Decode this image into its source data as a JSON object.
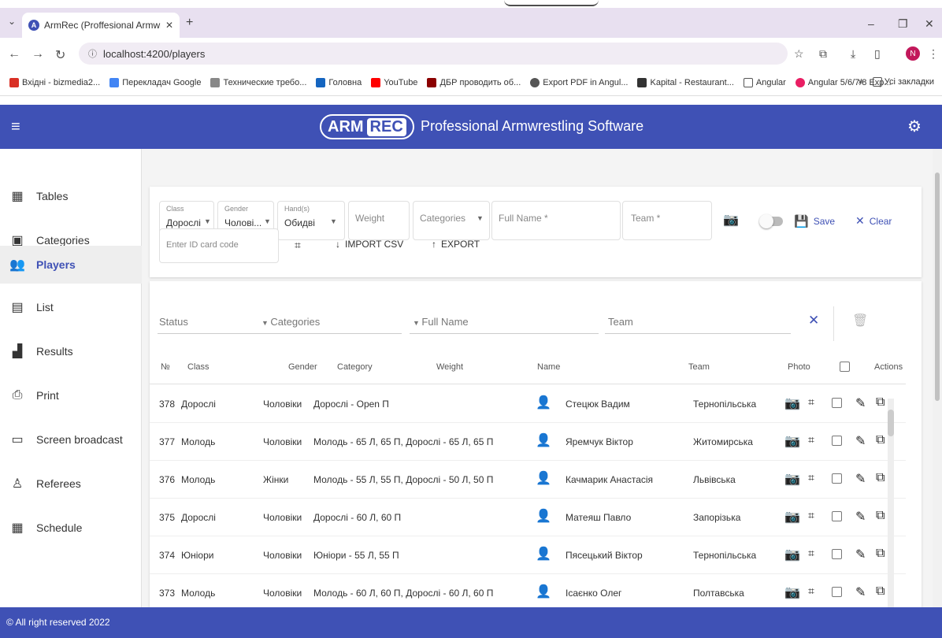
{
  "browser": {
    "tab_title": "ArmRec (Proffesional Armwrestl",
    "url": "localhost:4200/players",
    "bookmarks": [
      "Вхідні - bizmedia2...",
      "Перекладач Google",
      "Технические требо...",
      "Головна",
      "YouTube",
      "ДБР проводить об...",
      "Export PDF in Angul...",
      "Kapital - Restaurant...",
      "Angular",
      "Angular 5/6/7/8 Exp..."
    ],
    "bookmarks_more": "»",
    "bookmarks_folder": "Усі закладки",
    "profile_initial": "N"
  },
  "app": {
    "logo_left": "ARM",
    "logo_right": "REC",
    "subtitle": "Professional Armwrestling Software",
    "accent": "#3f51b5"
  },
  "sidebar": {
    "items": [
      {
        "label": "Tables",
        "icon": "tables-icon"
      },
      {
        "label": "Categories",
        "icon": "categories-icon"
      },
      {
        "label": "Players",
        "icon": "players-icon",
        "active": true
      },
      {
        "label": "List",
        "icon": "list-icon"
      },
      {
        "label": "Results",
        "icon": "results-icon"
      },
      {
        "label": "Print",
        "icon": "print-icon"
      },
      {
        "label": "Screen broadcast",
        "icon": "cast-icon"
      },
      {
        "label": "Referees",
        "icon": "referees-icon"
      },
      {
        "label": "Schedule",
        "icon": "schedule-icon"
      }
    ]
  },
  "form": {
    "class_label": "Class",
    "class_value": "Дорослі",
    "gender_label": "Gender",
    "gender_value": "Чолові...",
    "hands_label": "Hand(s)",
    "hands_value": "Обидві",
    "weight_placeholder": "Weight",
    "categories_placeholder": "Categories",
    "fullname_placeholder": "Full Name *",
    "team_placeholder": "Team *",
    "save_label": "Save",
    "clear_label": "Clear",
    "idcard_placeholder": "Enter ID card code",
    "import_label": "IMPORT CSV",
    "export_label": "EXPORT"
  },
  "filters": {
    "status": "Status",
    "categories": "Categories",
    "fullname": "Full Name",
    "team": "Team"
  },
  "table": {
    "headers": {
      "no": "№",
      "class": "Class",
      "gender": "Gender",
      "category": "Category",
      "weight": "Weight",
      "name": "Name",
      "team": "Team",
      "photo": "Photo",
      "actions": "Actions"
    },
    "rows": [
      {
        "no": "378",
        "class": "Дорослі",
        "gender": "Чоловіки",
        "category": "Дорослі - Open П",
        "name": "Стецюк Вадим",
        "team": "Тернопільська"
      },
      {
        "no": "377",
        "class": "Молодь",
        "gender": "Чоловіки",
        "category": "Молодь - 65 Л, 65 П, Дорослі - 65 Л, 65 П",
        "name": "Яремчук Віктор",
        "team": "Житомирська"
      },
      {
        "no": "376",
        "class": "Молодь",
        "gender": "Жінки",
        "category": "Молодь - 55 Л, 55 П, Дорослі - 50 Л, 50 П",
        "name": "Качмарик Анастасія",
        "team": "Львівська"
      },
      {
        "no": "375",
        "class": "Дорослі",
        "gender": "Чоловіки",
        "category": "Дорослі - 60 Л, 60 П",
        "name": "Матеяш Павло",
        "team": "Запорізька"
      },
      {
        "no": "374",
        "class": "Юніори",
        "gender": "Чоловіки",
        "category": "Юніори - 55 Л, 55 П",
        "name": "Пясецький Віктор",
        "team": "Тернопільська"
      },
      {
        "no": "373",
        "class": "Молодь",
        "gender": "Чоловіки",
        "category": "Молодь - 60 Л, 60 П, Дорослі - 60 Л, 60 П",
        "name": "Ісаєнко Олег",
        "team": "Полтавська"
      }
    ]
  },
  "footer": {
    "text": "© All right reserved 2022"
  }
}
